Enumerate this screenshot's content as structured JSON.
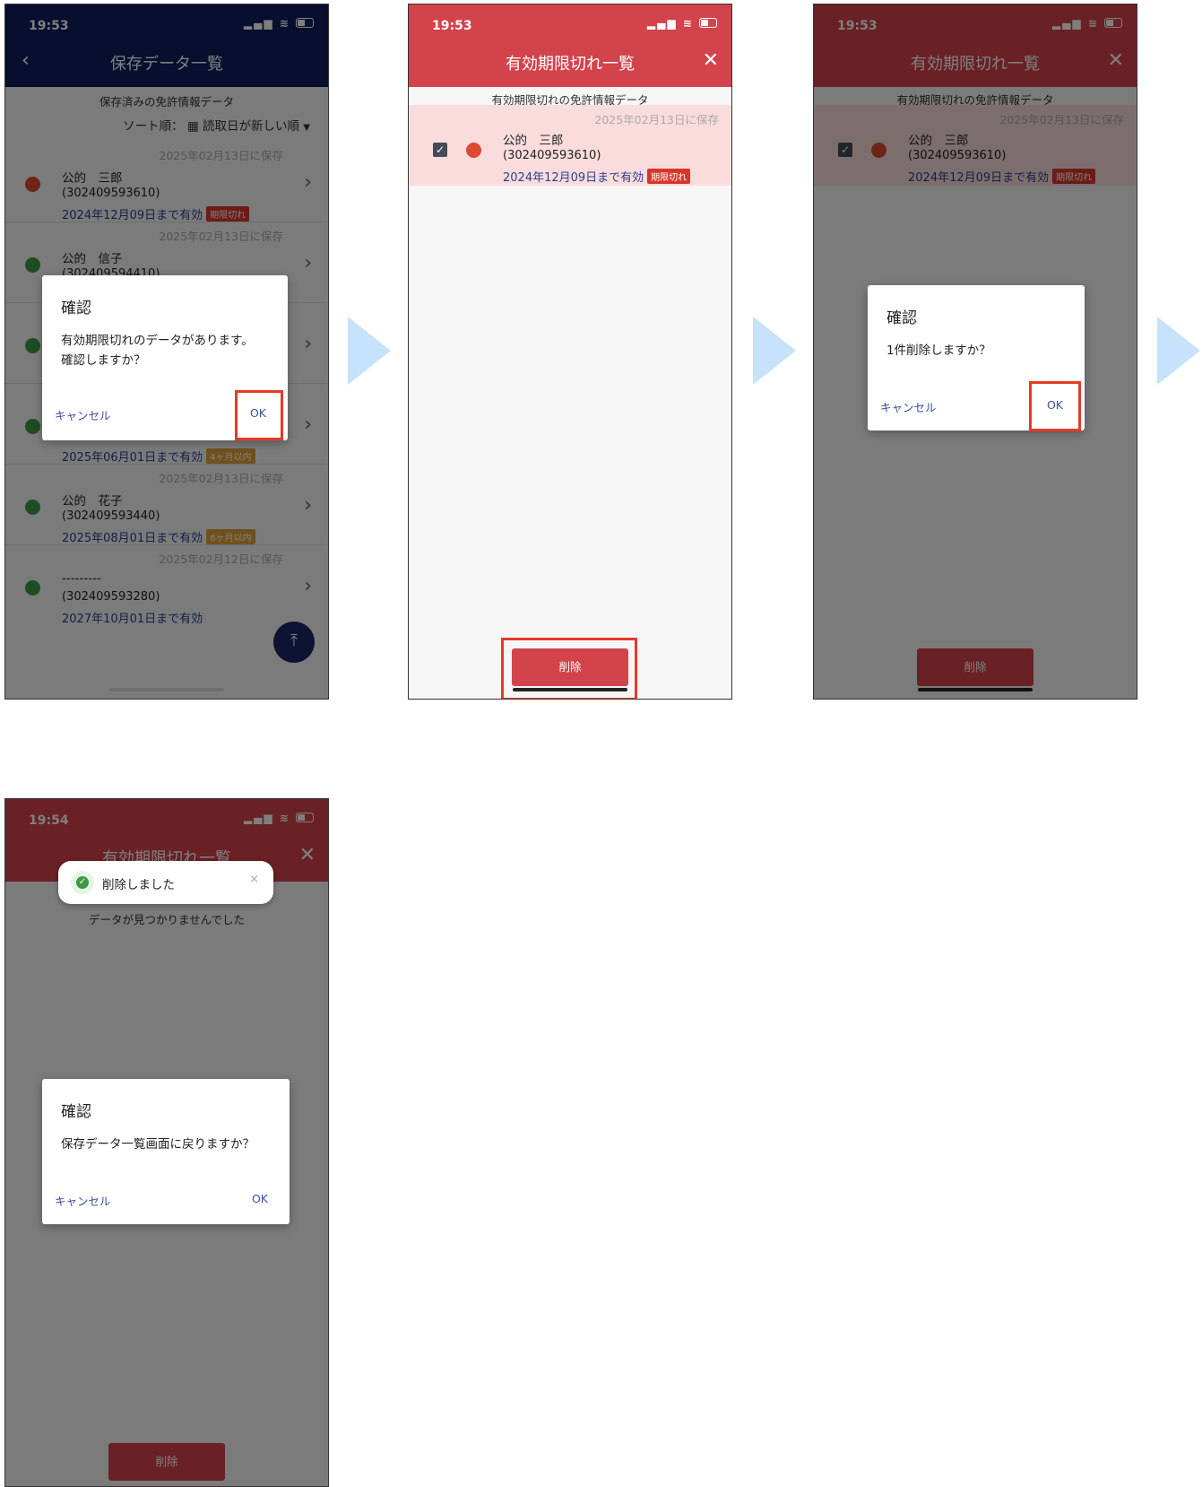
{
  "colors": {
    "navy_header": "#0f1d5d",
    "red_header": "#d2434b",
    "dark_red_header": "#6d2226",
    "expired_dot": "#dc4a32",
    "valid_dot": "#3e9b47",
    "expired_badge": "#d9362b",
    "warning_badge": "#e0a23a",
    "highlight_box": "#e53b25",
    "flow_arrow": "#c7e2fb"
  },
  "screen1": {
    "time": "19:53",
    "title": "保存データ一覧",
    "subtitle": "保存済みの免許情報データ",
    "sort_label": "ソート順：",
    "sort_value": "読取日が新しい順",
    "items": [
      {
        "saved": "2025年02月13日に保存",
        "name": "公的　三郎",
        "number": "(302409593610)",
        "expiry": "2024年12月09日まで有効",
        "badge": "期限切れ",
        "status": "expired"
      },
      {
        "saved": "2025年02月13日に保存",
        "name": "公的　信子",
        "number": "(302409594410)",
        "expiry": "",
        "badge": "",
        "status": "valid"
      },
      {
        "saved": "",
        "name": "",
        "number": "",
        "expiry": "",
        "badge": "",
        "status": "valid"
      },
      {
        "saved": "",
        "name": "",
        "number": "",
        "expiry": "2025年06月01日まで有効",
        "badge": "4ヶ月以内",
        "status": "valid"
      },
      {
        "saved": "2025年02月13日に保存",
        "name": "公的　花子",
        "number": "(302409593440)",
        "expiry": "2025年08月01日まで有効",
        "badge": "6ヶ月以内",
        "status": "valid"
      },
      {
        "saved": "2025年02月12日に保存",
        "name": "---------",
        "number": "(302409593280)",
        "expiry": "2027年10月01日まで有効",
        "badge": "",
        "status": "valid"
      }
    ],
    "fab_icon": "scroll-to-top-icon",
    "dialog": {
      "title": "確認",
      "message_line1": "有効期限切れのデータがあります。",
      "message_line2": "確認しますか？",
      "cancel": "キャンセル",
      "ok": "OK"
    }
  },
  "screen2": {
    "time": "19:53",
    "title": "有効期限切れ一覧",
    "subtitle": "有効期限切れの免許情報データ",
    "item": {
      "saved": "2025年02月13日に保存",
      "name": "公的　三郎",
      "number": "(302409593610)",
      "expiry": "2024年12月09日まで有効",
      "badge": "期限切れ",
      "checked": true
    },
    "delete_label": "削除"
  },
  "screen3": {
    "time": "19:53",
    "title": "有効期限切れ一覧",
    "subtitle": "有効期限切れの免許情報データ",
    "item": {
      "saved": "2025年02月13日に保存",
      "name": "公的　三郎",
      "number": "(302409593610)",
      "expiry": "2024年12月09日まで有効",
      "badge": "期限切れ",
      "checked": true
    },
    "delete_label": "削除",
    "dialog": {
      "title": "確認",
      "message": "1件削除しますか？",
      "cancel": "キャンセル",
      "ok": "OK"
    }
  },
  "screen4": {
    "time": "19:54",
    "title": "有効期限切れ一覧",
    "toast": "削除しました",
    "toast_close": "×",
    "empty_message": "データが見つかりませんでした",
    "delete_label": "削除",
    "dialog": {
      "title": "確認",
      "message": "保存データ一覧画面に戻りますか？",
      "cancel": "キャンセル",
      "ok": "OK"
    }
  }
}
